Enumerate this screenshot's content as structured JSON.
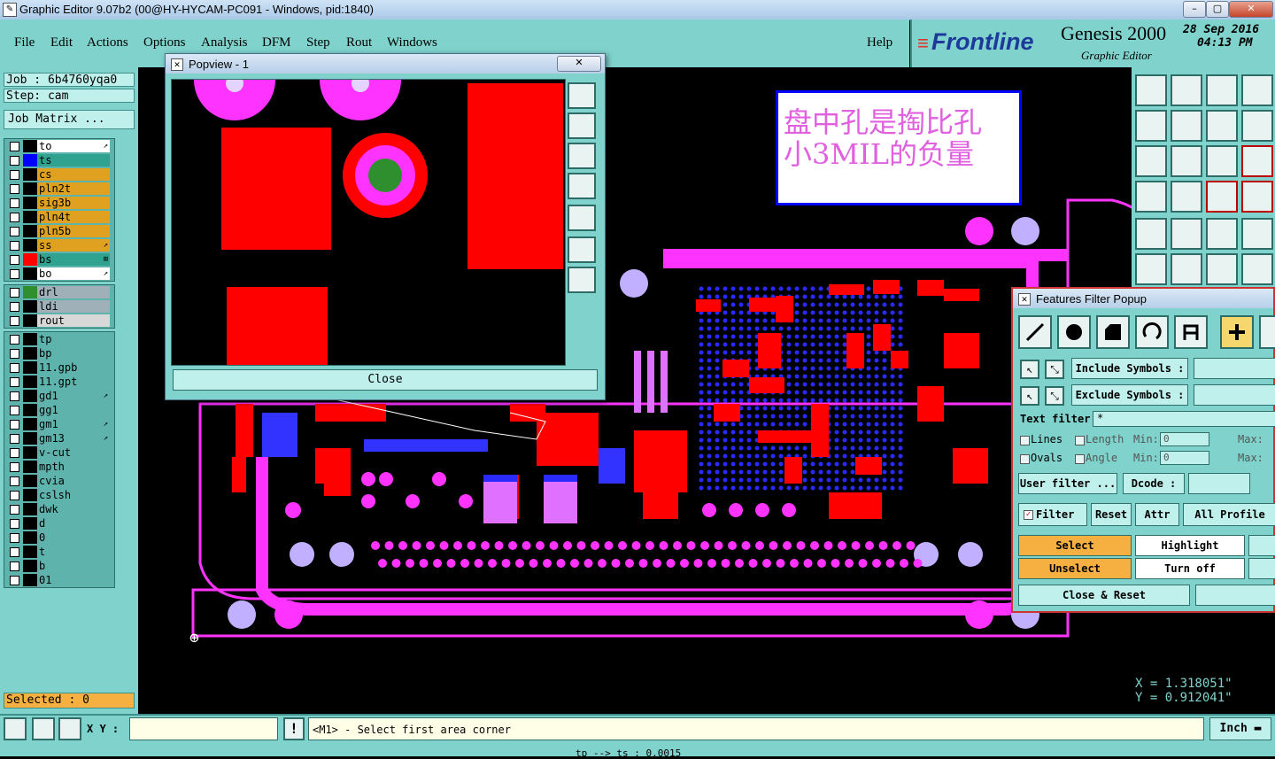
{
  "window": {
    "title": "Graphic Editor 9.07b2 (00@HY-HYCAM-PC091 - Windows, pid:1840)"
  },
  "menu": [
    "File",
    "Edit",
    "Actions",
    "Options",
    "Analysis",
    "DFM",
    "Step",
    "Rout",
    "Windows"
  ],
  "help_label": "Help",
  "brand": {
    "logo": "Frontline",
    "product": "Genesis 2000",
    "subtitle": "Graphic Editor",
    "date": "28 Sep 2016",
    "time": "04:13 PM"
  },
  "job": {
    "job_label": "Job : 6b4760yqa0",
    "step_label": "Step: cam",
    "matrix_button": "Job Matrix ..."
  },
  "layers_group1": [
    {
      "name": "to",
      "color": "#ffffff",
      "swatch": "#000000",
      "mark": "↗"
    },
    {
      "name": "ts",
      "color": "#2fa38f",
      "swatch": "#0000ff",
      "mark": ""
    },
    {
      "name": "cs",
      "color": "#e0a020",
      "swatch": "#000000",
      "mark": ""
    },
    {
      "name": "pln2t",
      "color": "#e0a020",
      "swatch": "#000000",
      "mark": ""
    },
    {
      "name": "sig3b",
      "color": "#e0a020",
      "swatch": "#000000",
      "mark": ""
    },
    {
      "name": "pln4t",
      "color": "#e0a020",
      "swatch": "#000000",
      "mark": ""
    },
    {
      "name": "pln5b",
      "color": "#e0a020",
      "swatch": "#000000",
      "mark": ""
    },
    {
      "name": "ss",
      "color": "#e0a020",
      "swatch": "#000000",
      "mark": "↗"
    },
    {
      "name": "bs",
      "color": "#2fa38f",
      "swatch": "#ff0000",
      "mark": "⊞"
    },
    {
      "name": "bo",
      "color": "#ffffff",
      "swatch": "#000000",
      "mark": "↗"
    }
  ],
  "layers_group2": [
    {
      "name": "drl",
      "color": "#9fb0b8",
      "swatch": "#2f8f2f"
    },
    {
      "name": "ldi",
      "color": "#9fb0b8",
      "swatch": "#000000"
    },
    {
      "name": "rout",
      "color": "#d8d8d8",
      "swatch": "#000000"
    }
  ],
  "layers_group3": [
    {
      "name": "tp",
      "mark": ""
    },
    {
      "name": "bp",
      "mark": ""
    },
    {
      "name": "11.gpb",
      "mark": ""
    },
    {
      "name": "11.gpt",
      "mark": ""
    },
    {
      "name": "gd1",
      "mark": "↗"
    },
    {
      "name": "gg1",
      "mark": ""
    },
    {
      "name": "gm1",
      "mark": "↗"
    },
    {
      "name": "gm13",
      "mark": "↗"
    },
    {
      "name": "v-cut",
      "mark": ""
    },
    {
      "name": "mpth",
      "mark": ""
    },
    {
      "name": "cvia",
      "mark": ""
    },
    {
      "name": "cslsh",
      "mark": ""
    },
    {
      "name": "dwk",
      "mark": ""
    },
    {
      "name": "d",
      "mark": ""
    },
    {
      "name": "0",
      "mark": ""
    },
    {
      "name": "t",
      "mark": ""
    },
    {
      "name": "b",
      "mark": ""
    },
    {
      "name": "01",
      "mark": ""
    }
  ],
  "selected_label": "Selected : 0",
  "annotation": {
    "line1": "盘中孔是掏比孔",
    "line2": "小3MIL的负量"
  },
  "popview": {
    "title": "Popview - 1",
    "close_label": "Close"
  },
  "filter": {
    "title": "Features Filter Popup",
    "include_label": "Include Symbols :",
    "exclude_label": "Exclude Symbols :",
    "text_filter_label": "Text filter",
    "text_filter_value": "*",
    "lines_label": "Lines",
    "ovals_label": "Ovals",
    "length_label": "Length",
    "angle_label": "Angle",
    "min_label": "Min:",
    "max_label": "Max:",
    "length_min": "0",
    "angle_min": "0",
    "user_filter_label": "User filter ...",
    "dcode_label": "Dcode :",
    "filter_label": "Filter",
    "reset_label": "Reset",
    "attr_label": "Attr ...",
    "all_profile_label": "All Profile",
    "select_label": "Select",
    "highlight_label": "Highlight",
    "unselect_label": "Unselect",
    "turnoff_label": "Turn off",
    "close_reset_label": "Close & Reset"
  },
  "coords": {
    "x": "X  = 1.318051\"",
    "y": "Y  = 0.912041\""
  },
  "status": {
    "xy_label": "X Y :",
    "message": "<M1> - Select first area corner",
    "units": "Inch"
  },
  "bottom": {
    "text": "tp --> ts : 0.0015"
  }
}
